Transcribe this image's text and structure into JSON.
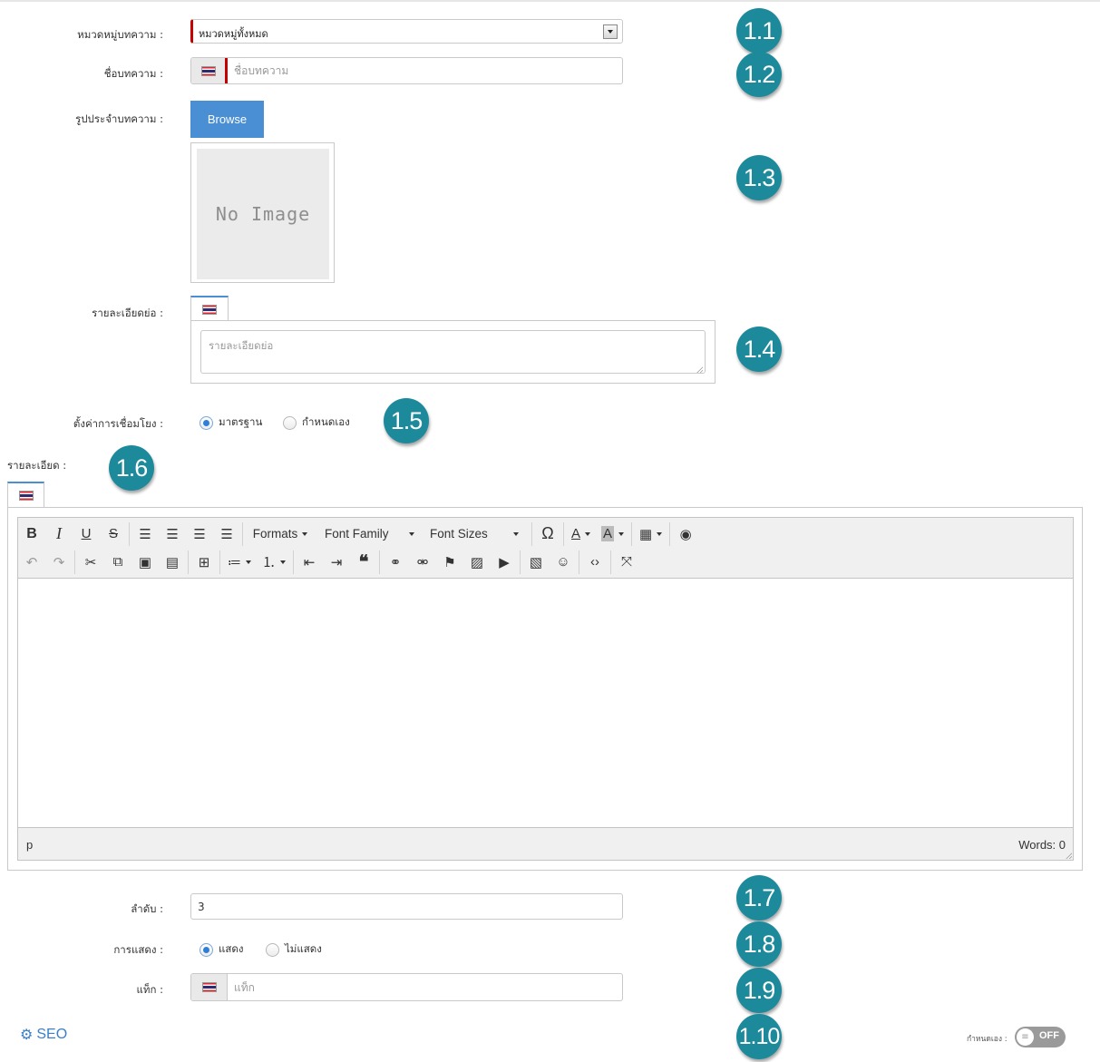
{
  "form": {
    "category": {
      "label": "หมวดหมู่บทความ :",
      "value": "หมวดหมู่ทั้งหมด"
    },
    "title": {
      "label": "ชื่อบทความ :",
      "placeholder": "ชื่อบทความ"
    },
    "image": {
      "label": "รูปประจำบทความ :",
      "browse_label": "Browse",
      "placeholder_text": "No Image"
    },
    "summary": {
      "label": "รายละเอียดย่อ :",
      "placeholder": "รายละเอียดย่อ"
    },
    "link_setting": {
      "label": "ตั้งค่าการเชื่อมโยง :",
      "options": [
        "มาตรฐาน",
        "กำหนดเอง"
      ],
      "selected": "มาตรฐาน"
    },
    "detail": {
      "label": "รายละเอียด :"
    },
    "order": {
      "label": "ลำดับ :",
      "value": "3"
    },
    "display": {
      "label": "การแสดง :",
      "options": [
        "แสดง",
        "ไม่แสดง"
      ],
      "selected": "แสดง"
    },
    "tags": {
      "label": "แท็ก :",
      "placeholder": "แท็ก"
    }
  },
  "editor": {
    "toolbar_row1": {
      "formats": "Formats",
      "font_family": "Font Family",
      "font_sizes": "Font Sizes"
    },
    "status_path": "p",
    "word_count": "Words: 0"
  },
  "badges": [
    "1.1",
    "1.2",
    "1.3",
    "1.4",
    "1.5",
    "1.6",
    "1.7",
    "1.8",
    "1.9",
    "1.10"
  ],
  "seo": {
    "label": "SEO"
  },
  "custom_toggle": {
    "label": "กำหนดเอง :",
    "state": "OFF"
  },
  "colors": {
    "badge": "#1d8a9c",
    "required_marker": "#c40000",
    "button": "#4a8fd4",
    "link": "#3a7fc9"
  }
}
